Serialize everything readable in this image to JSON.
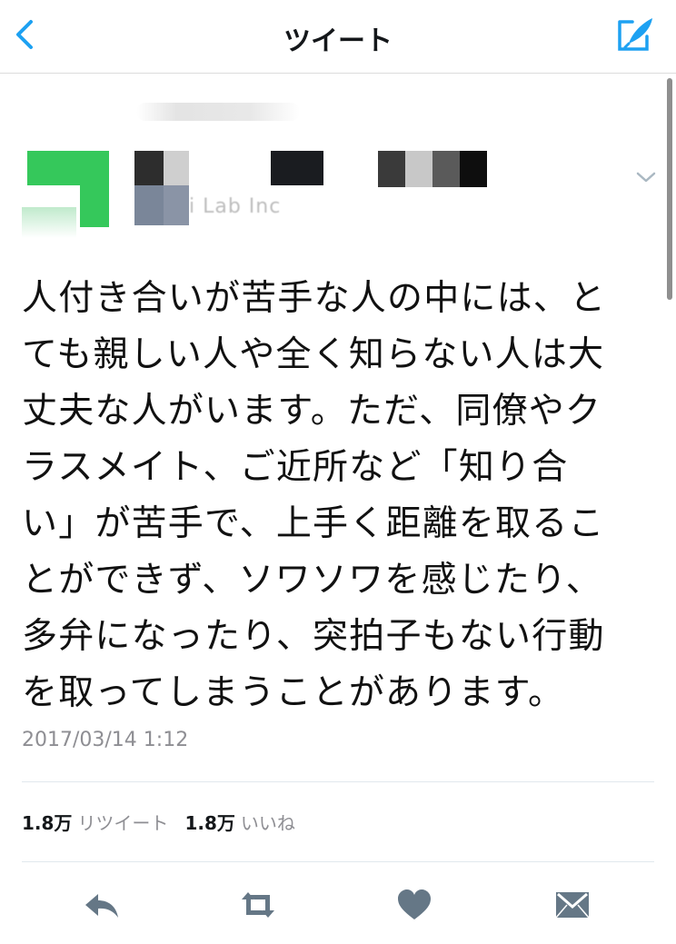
{
  "nav": {
    "title": "ツイート",
    "back_icon": "chevron-left-icon",
    "compose_icon": "compose-tweet-icon",
    "accent": "#1da1f2"
  },
  "author": {
    "handle_fragment": "i Lab Inc"
  },
  "tweet": {
    "lines": [
      "人付き合いが苦手な人の中には、と",
      "ても親しい人や全く知らない人は大",
      "丈夫な人がいます。ただ、同僚やク",
      "ラスメイト、ご近所など「知り合",
      "い」が苦手で、上手く距離を取るこ",
      "とができず、ソワソワを感じたり、",
      "多弁になったり、突拍子もない行動",
      "を取ってしまうことがあります。"
    ],
    "timestamp": "2017/03/14 1:12"
  },
  "stats": {
    "retweet_count": "1.8万",
    "retweet_label": "リツイート",
    "like_count": "1.8万",
    "like_label": "いいね"
  },
  "actions": {
    "icons": [
      "reply-icon",
      "retweet-icon",
      "like-heart-icon",
      "direct-message-icon"
    ],
    "color": "#657786"
  }
}
